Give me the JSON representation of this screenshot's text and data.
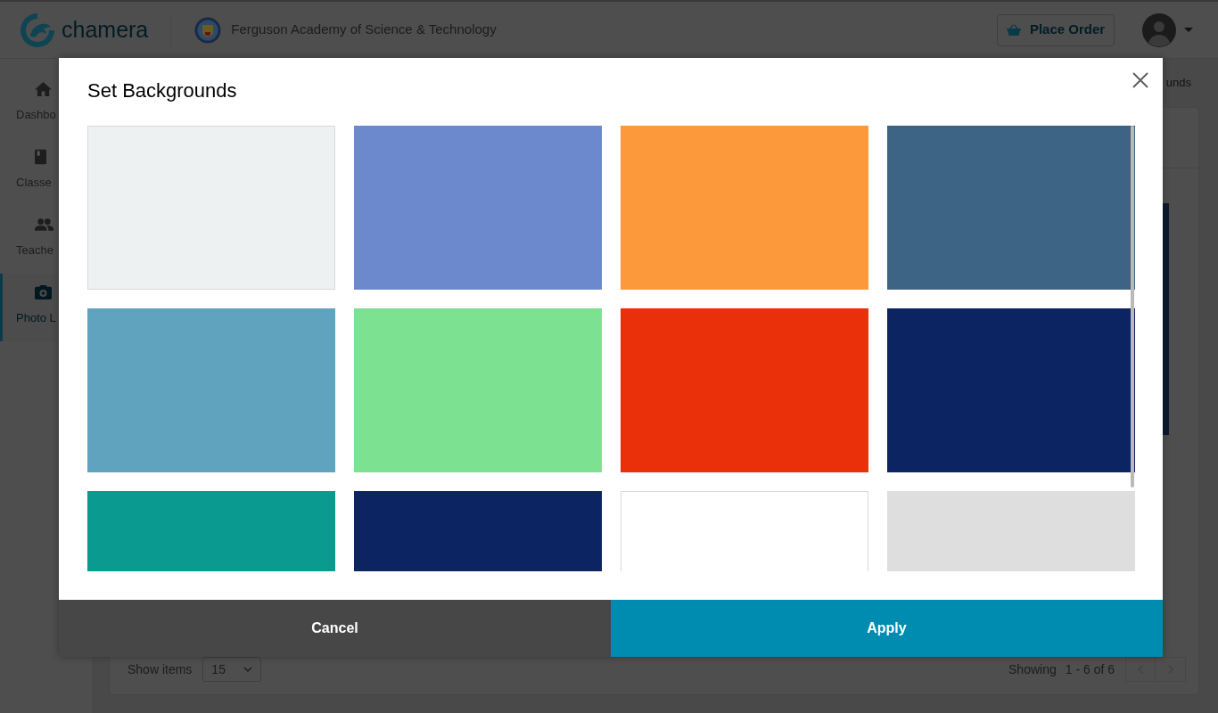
{
  "header": {
    "logo_text": "chamera",
    "school_name": "Ferguson Academy of Science & Technology",
    "place_order_button": "Place Order"
  },
  "sidebar": {
    "items": [
      {
        "label": "Dashbo",
        "selected": false
      },
      {
        "label": "Classe",
        "selected": false
      },
      {
        "label": "Teache",
        "selected": false
      },
      {
        "label": "Photo L",
        "selected": true
      }
    ]
  },
  "breadcrumb": {
    "text": "unds"
  },
  "pagination": {
    "show_items_label": "Show items",
    "page_size": "15",
    "showing_label": "Showing",
    "range": "1 - 6 of 6"
  },
  "modal": {
    "title": "Set Backgrounds",
    "swatches": [
      {
        "color": "#eef1f2"
      },
      {
        "color": "#6b89cc"
      },
      {
        "color": "#fb993b"
      },
      {
        "color": "#3d6484"
      },
      {
        "color": "#60a3be"
      },
      {
        "color": "#7ce191"
      },
      {
        "color": "#e9300a"
      },
      {
        "color": "#0c2462"
      },
      {
        "color": "#0a9a8f"
      },
      {
        "color": "#0c2462"
      },
      {
        "color": "#ffffff"
      },
      {
        "color": "#dedede"
      }
    ],
    "buttons": [
      {
        "label": "Cancel",
        "kind": "secondary"
      },
      {
        "label": "Apply",
        "kind": "primary"
      }
    ]
  }
}
